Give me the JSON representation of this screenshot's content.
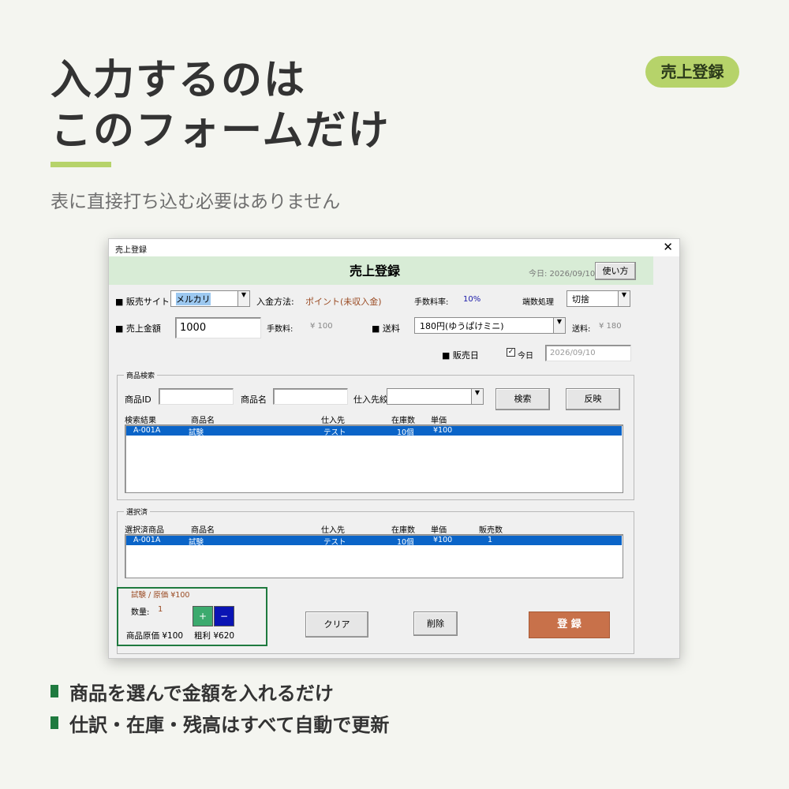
{
  "headline": {
    "line1": "入力するのは",
    "line2": "このフォームだけ"
  },
  "subtitle": "表に直接打ち込む必要はありません",
  "badge": "売上登録",
  "bullets": [
    "商品を選んで金額を入れるだけ",
    "仕訳・在庫・残高はすべて自動で更新"
  ],
  "colors": {
    "accent": "#b6d36a",
    "bullet": "#1f7a3f",
    "header_bg": "#d8ecd6",
    "register_btn": "#c8714a",
    "selection": "#0a64c8",
    "plus_btn": "#3caa6e",
    "minus_btn": "#0a14b4"
  },
  "window": {
    "title": "売上登録",
    "close_icon": "close-icon",
    "header_title": "売上登録",
    "today_label": "今日: 2026/09/10",
    "help_button": "使い方",
    "sales_site_label": "■ 販売サイト",
    "sales_site_value": "メルカリ",
    "payment_method_label": "入金方法:",
    "payment_method_value": "ポイント(未収入金)",
    "fee_rate_label": "手数料率:",
    "fee_rate_value": "10%",
    "rounding_label": "端数処理",
    "rounding_value": "切捨",
    "sales_amount_label": "■ 売上金額",
    "sales_amount_value": "1000",
    "fee_label": "手数料:",
    "fee_value": "¥ 100",
    "shipping_label": "■ 送料",
    "shipping_value": "180円(ゆうぱけミニ)",
    "shipping_cost_label": "送料:",
    "shipping_cost_value": "¥ 180",
    "sale_date_label": "■ 販売日",
    "today_check_label": "今日",
    "sale_date_value": "2026/09/10",
    "search_group": {
      "label": "商品検索",
      "id_label": "商品ID",
      "name_label": "商品名",
      "supplier_filter_label": "仕入先絞込",
      "search_button": "検索",
      "apply_button": "反映",
      "columns": [
        "検索結果",
        "商品名",
        "仕入先",
        "在庫数",
        "単価"
      ],
      "rows": [
        {
          "id": "A-001A",
          "name": "試験",
          "supplier": "テスト",
          "stock": "10個",
          "price": "¥100"
        }
      ]
    },
    "selected_group": {
      "label": "選択済",
      "columns": [
        "選択済商品",
        "商品名",
        "仕入先",
        "在庫数",
        "単価",
        "販売数"
      ],
      "rows": [
        {
          "id": "A-001A",
          "name": "試験",
          "supplier": "テスト",
          "stock": "10個",
          "price": "¥100",
          "qty": "1"
        }
      ],
      "info": "試験 / 原価 ¥100",
      "qty_label": "数量:",
      "qty_value": "1",
      "plus_label": "+",
      "minus_label": "−",
      "cost_label": "商品原価 ¥100",
      "profit_label": "粗利 ¥620",
      "clear_button": "クリア",
      "delete_button": "削除",
      "register_button": "登 録"
    }
  }
}
